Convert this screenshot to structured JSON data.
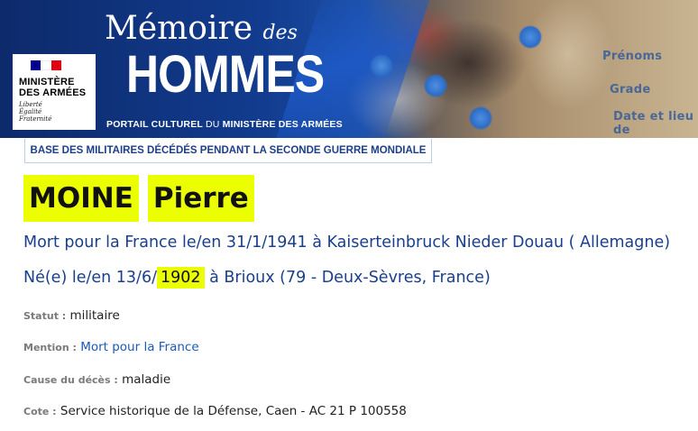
{
  "header": {
    "logo": {
      "line1": "MINISTÈRE",
      "line2": "DES ARMÉES",
      "motto1": "Liberté",
      "motto2": "Égalité",
      "motto3": "Fraternité",
      "flag_colors": [
        "#000091",
        "#ffffff",
        "#e1000f"
      ]
    },
    "site_title_1": "Mémoire",
    "site_title_des": "des",
    "site_title_2": "HOMMES",
    "subtitle_bold_1": "PORTAIL CULTUREL",
    "subtitle_light": "DU",
    "subtitle_bold_2": "MINISTÈRE DES ARMÉES",
    "card_labels": [
      "Prénoms",
      "Grade",
      "Date et lieu de"
    ]
  },
  "database_label": "BASE DES MILITAIRES DÉCÉDÉS PENDANT LA SECONDE GUERRE MONDIALE",
  "person": {
    "last_name": "MOINE",
    "first_name": "Pierre",
    "death_line": "Mort pour la France le/en 31/1/1941 à Kaiserteinbruck Nieder Douau ( Allemagne)",
    "birth_prefix": "Né(e) le/en 13/6/",
    "birth_year": "1902",
    "birth_suffix": " à Brioux (79 - Deux-Sèvres, France)"
  },
  "details": {
    "statut_label": "Statut :",
    "statut_value": "militaire",
    "mention_label": "Mention :",
    "mention_value": "Mort pour la France",
    "cause_label": "Cause du décès :",
    "cause_value": "maladie",
    "cote_label": "Cote :",
    "cote_value": "Service historique de la Défense, Caen - AC 21 P 100558"
  },
  "colors": {
    "highlight": "#ebff00",
    "primary_blue": "#1a3f8c",
    "link_blue": "#1a5ab8",
    "label_gray": "#7a7a7a"
  }
}
